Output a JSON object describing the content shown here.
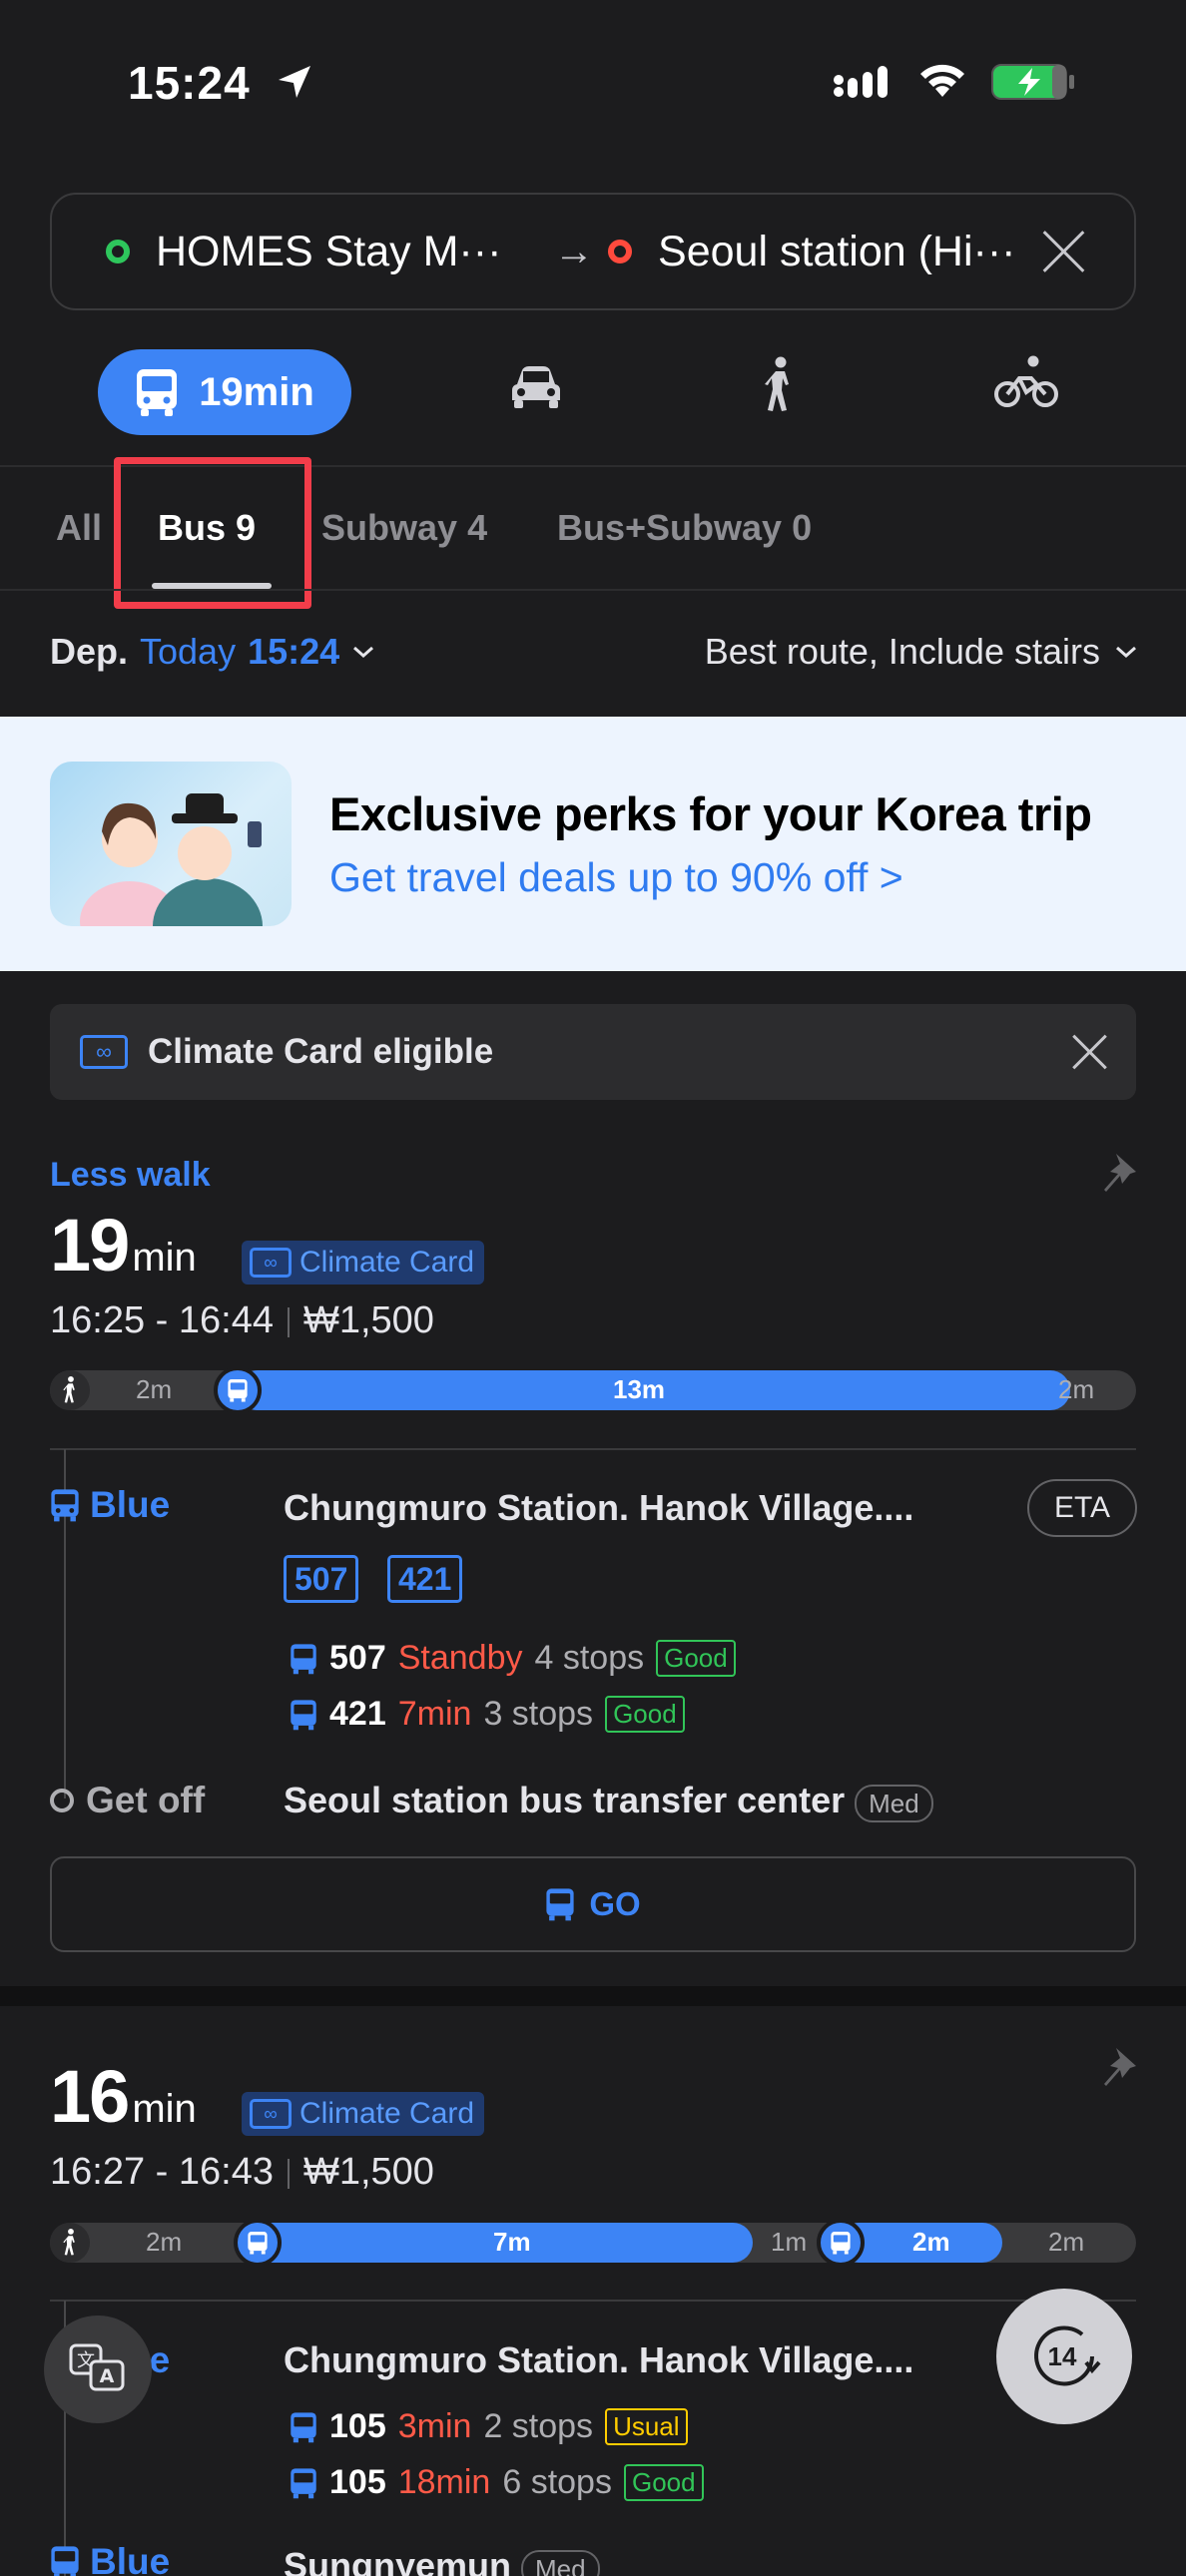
{
  "status": {
    "time": "15:24"
  },
  "route": {
    "origin": "HOMES Stay M···",
    "destination": "Seoul station (Hi···"
  },
  "modes": {
    "transit_time": "19min"
  },
  "tabs": [
    {
      "label": "All",
      "count": ""
    },
    {
      "label": "Bus",
      "count": "9"
    },
    {
      "label": "Subway",
      "count": "4"
    },
    {
      "label": "Bus+Subway",
      "count": "0"
    }
  ],
  "departure": {
    "prefix": "Dep.",
    "day": "Today",
    "time": "15:24",
    "options": "Best route, Include stairs"
  },
  "ad": {
    "title": "Exclusive perks for your Korea trip",
    "subtitle": "Get travel deals up to 90% off >"
  },
  "climate_banner": {
    "label": "Climate Card eligible"
  },
  "results": [
    {
      "tag": "Less walk",
      "duration": "19",
      "unit": "min",
      "badge": "Climate Card",
      "time_range": "16:25 - 16:44",
      "fare": "₩1,500",
      "timeline": [
        "2m",
        "13m",
        "2m"
      ],
      "leg_label": "Blue",
      "stop": "Chungmuro Station. Hanok Village....",
      "eta": "ETA",
      "chips": [
        "507",
        "421"
      ],
      "buses": [
        {
          "number": "507",
          "status": "Standby",
          "stops": "4 stops",
          "crowd": "Good"
        },
        {
          "number": "421",
          "status": "7min",
          "stops": "3 stops",
          "crowd": "Good"
        }
      ],
      "getoff_label": "Get off",
      "getoff_stop": "Seoul station bus transfer center",
      "getoff_crowd": "Med",
      "go": "GO"
    },
    {
      "tag": "",
      "duration": "16",
      "unit": "min",
      "badge": "Climate Card",
      "time_range": "16:27 - 16:43",
      "fare": "₩1,500",
      "timeline": [
        "2m",
        "7m",
        "1m",
        "2m",
        "2m"
      ],
      "leg_label": "Blue",
      "stop": "Chungmuro Station. Hanok Village....",
      "buses": [
        {
          "number": "105",
          "status": "3min",
          "stops": "2 stops",
          "crowd": "Usual"
        },
        {
          "number": "105",
          "status": "18min",
          "stops": "6 stops",
          "crowd": "Good"
        }
      ],
      "next_leg_label": "Blue",
      "next_stop": "Sungnyemun",
      "next_crowd": "Med"
    }
  ],
  "fab": {
    "time_shift": "14"
  },
  "colors": {
    "accent": "#3d84f5",
    "highlight": "#f23d4a",
    "good": "#31c558",
    "usual": "#ffcc00",
    "late": "#ff5a48"
  }
}
